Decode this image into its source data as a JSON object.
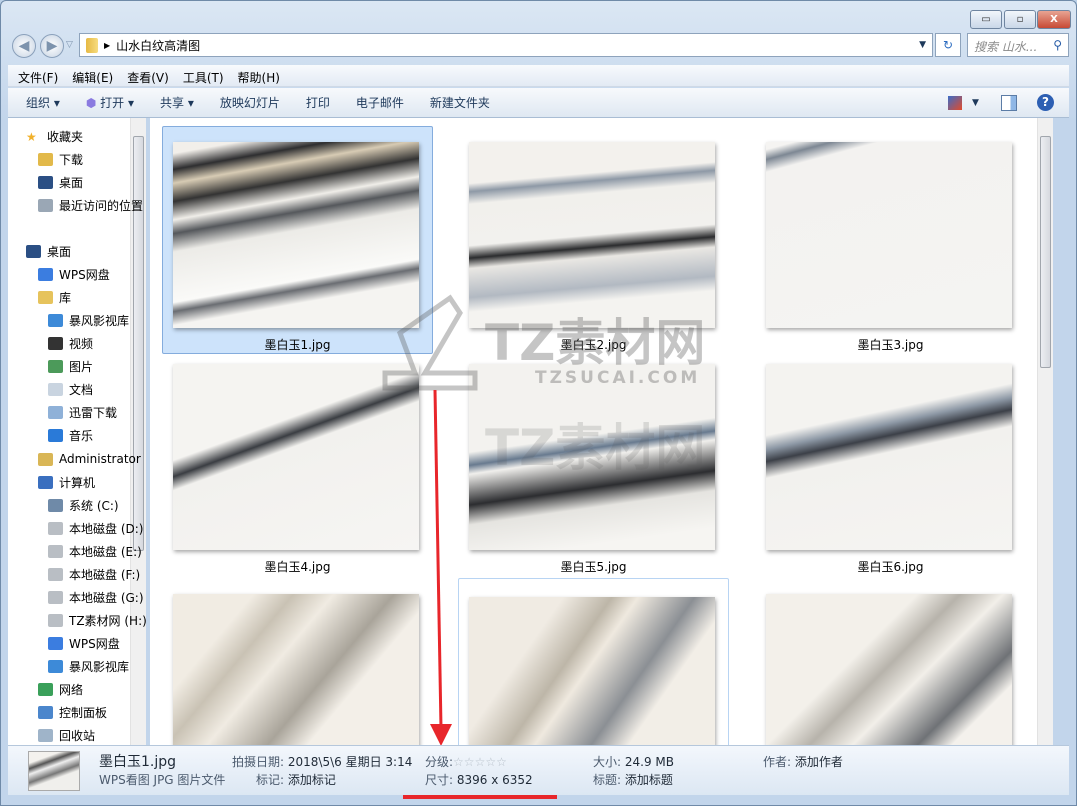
{
  "window": {
    "minimize": "▭",
    "maximize": "▫",
    "close": "X"
  },
  "address": {
    "path": "山水白纹高清图",
    "search_placeholder": "搜索 山水..."
  },
  "menu": [
    "文件(F)",
    "编辑(E)",
    "查看(V)",
    "工具(T)",
    "帮助(H)"
  ],
  "toolbar": {
    "organize": "组织 ▾",
    "open": "打开",
    "share": "共享 ▾",
    "slideshow": "放映幻灯片",
    "print": "打印",
    "email": "电子邮件",
    "new_folder": "新建文件夹"
  },
  "nav": [
    {
      "label": "收藏夹",
      "icon": "star-icon",
      "indent": 0
    },
    {
      "label": "下载",
      "icon": "downloads-icon",
      "indent": 1
    },
    {
      "label": "桌面",
      "icon": "desktop-icon",
      "indent": 1
    },
    {
      "label": "最近访问的位置",
      "icon": "recent-places-icon",
      "indent": 1
    },
    {
      "label": "桌面",
      "icon": "desktop-icon",
      "indent": 0
    },
    {
      "label": "WPS网盘",
      "icon": "cloud-icon",
      "indent": 1
    },
    {
      "label": "库",
      "icon": "library-icon",
      "indent": 1
    },
    {
      "label": "暴风影视库",
      "icon": "video-library-icon",
      "indent": 2
    },
    {
      "label": "视频",
      "icon": "video-icon",
      "indent": 2
    },
    {
      "label": "图片",
      "icon": "pictures-icon",
      "indent": 2
    },
    {
      "label": "文档",
      "icon": "documents-icon",
      "indent": 2
    },
    {
      "label": "迅雷下载",
      "icon": "thunder-download-icon",
      "indent": 2
    },
    {
      "label": "音乐",
      "icon": "music-icon",
      "indent": 2
    },
    {
      "label": "Administrator",
      "icon": "user-folder-icon",
      "indent": 1
    },
    {
      "label": "计算机",
      "icon": "computer-icon",
      "indent": 1
    },
    {
      "label": "系统 (C:)",
      "icon": "system-drive-icon",
      "indent": 2
    },
    {
      "label": "本地磁盘 (D:)",
      "icon": "drive-icon",
      "indent": 2
    },
    {
      "label": "本地磁盘 (E:)",
      "icon": "drive-icon",
      "indent": 2
    },
    {
      "label": "本地磁盘 (F:)",
      "icon": "drive-icon",
      "indent": 2
    },
    {
      "label": "本地磁盘 (G:)",
      "icon": "drive-icon",
      "indent": 2
    },
    {
      "label": "TZ素材网 (H:)",
      "icon": "drive-icon",
      "indent": 2
    },
    {
      "label": "WPS网盘",
      "icon": "cloud-icon",
      "indent": 2
    },
    {
      "label": "暴风影视库",
      "icon": "video-library-icon",
      "indent": 2
    },
    {
      "label": "网络",
      "icon": "network-icon",
      "indent": 1
    },
    {
      "label": "控制面板",
      "icon": "control-panel-icon",
      "indent": 1
    },
    {
      "label": "回收站",
      "icon": "recycle-bin-icon",
      "indent": 1
    }
  ],
  "files": [
    "墨白玉1.jpg",
    "墨白玉2.jpg",
    "墨白玉3.jpg",
    "墨白玉4.jpg",
    "墨白玉5.jpg",
    "墨白玉6.jpg",
    "",
    "",
    ""
  ],
  "watermark": {
    "brand": "TZ素材网",
    "url": "TZSUCAI.COM"
  },
  "details": {
    "name": "墨白玉1.jpg",
    "type": "WPS看图 JPG 图片文件",
    "date_label": "拍摄日期:",
    "date": "2018\\5\\6 星期日 3:14",
    "tags_label": "标记:",
    "tags": "添加标记",
    "rating_label": "分级:",
    "rating": "☆☆☆☆☆",
    "dims_label": "尺寸:",
    "dims": "8396 x 6352",
    "size_label": "大小:",
    "size": "24.9 MB",
    "title_label": "标题:",
    "title": "添加标题",
    "author_label": "作者:",
    "author": "添加作者"
  },
  "colors": {
    "annotation": "#e8262b",
    "selection": "#cde3fb"
  }
}
